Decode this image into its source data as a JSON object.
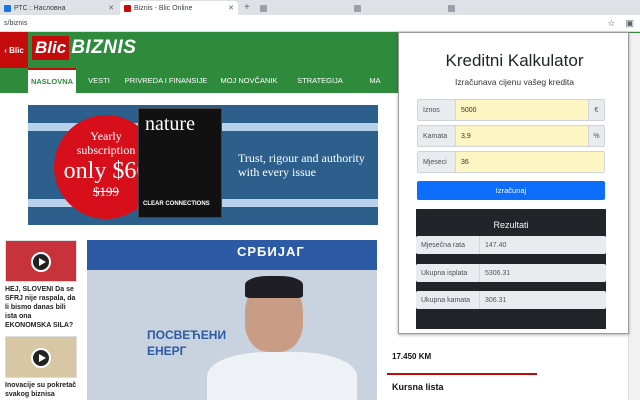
{
  "browser": {
    "tabs": [
      {
        "title": "РТС : Насловна",
        "favicon_color": "#1a73e8"
      },
      {
        "title": "Biznis - Blic Online",
        "favicon_color": "#c40a0a"
      },
      {
        "title": "",
        "favicon_color": "#9aa0a6"
      },
      {
        "title": "",
        "favicon_color": "#9aa0a6"
      },
      {
        "title": "",
        "favicon_color": "#9aa0a6"
      }
    ],
    "new_tab": "+",
    "address": "s/biznis",
    "address_icons": [
      "star-icon",
      "extension-icon"
    ]
  },
  "site": {
    "back_label": "‹ Blic",
    "logo_blic": "Blic",
    "logo_biznis": "BIZNIS",
    "nav": [
      "NASLOVNA",
      "VESTI",
      "PRIVREDA I FINANSIJE",
      "MOJ NOVČANIK",
      "STRATEGIJA",
      "MA"
    ],
    "banner": {
      "circle_line1": "Yearly",
      "circle_line2": "subscription",
      "circle_price": "only $66",
      "circle_old": "$199",
      "magazine_title": "nature",
      "magazine_caption": "CLEAR CONNECTIONS",
      "text_line1": "Trust, rigour and authority",
      "text_line2": "with every issue"
    },
    "articles": [
      {
        "title": "HEJ, SLOVENI Da se SFRJ nije raspala, da li bismo danas bili ista ona EKONOMSKA SILA?"
      },
      {
        "title": "Inovacije su pokretač svakog biznisa"
      }
    ],
    "photo_sign1": "СРБИЈАГ",
    "photo_sign2": "ПОСВЕЋЕНИ",
    "photo_sign3": "ЕНЕРГ",
    "price": "17.450 KM",
    "kursna_lista": "Kursna lista"
  },
  "calculator": {
    "title": "Kreditni Kalkulator",
    "subtitle": "Izračunava cijenu vašeg kredita",
    "fields": [
      {
        "label": "Iznos",
        "value": "5000",
        "unit": "€"
      },
      {
        "label": "Kamata",
        "value": "3,9",
        "unit": "%"
      },
      {
        "label": "Mjeseci",
        "value": "36",
        "unit": ""
      }
    ],
    "button": "Izračunaj",
    "results_title": "Rezultati",
    "results": [
      {
        "label": "Mjesečna rata",
        "value": "147.40"
      },
      {
        "label": "Ukupna isplata",
        "value": "5306.31"
      },
      {
        "label": "Ukupna kamata",
        "value": "306.31"
      }
    ]
  }
}
